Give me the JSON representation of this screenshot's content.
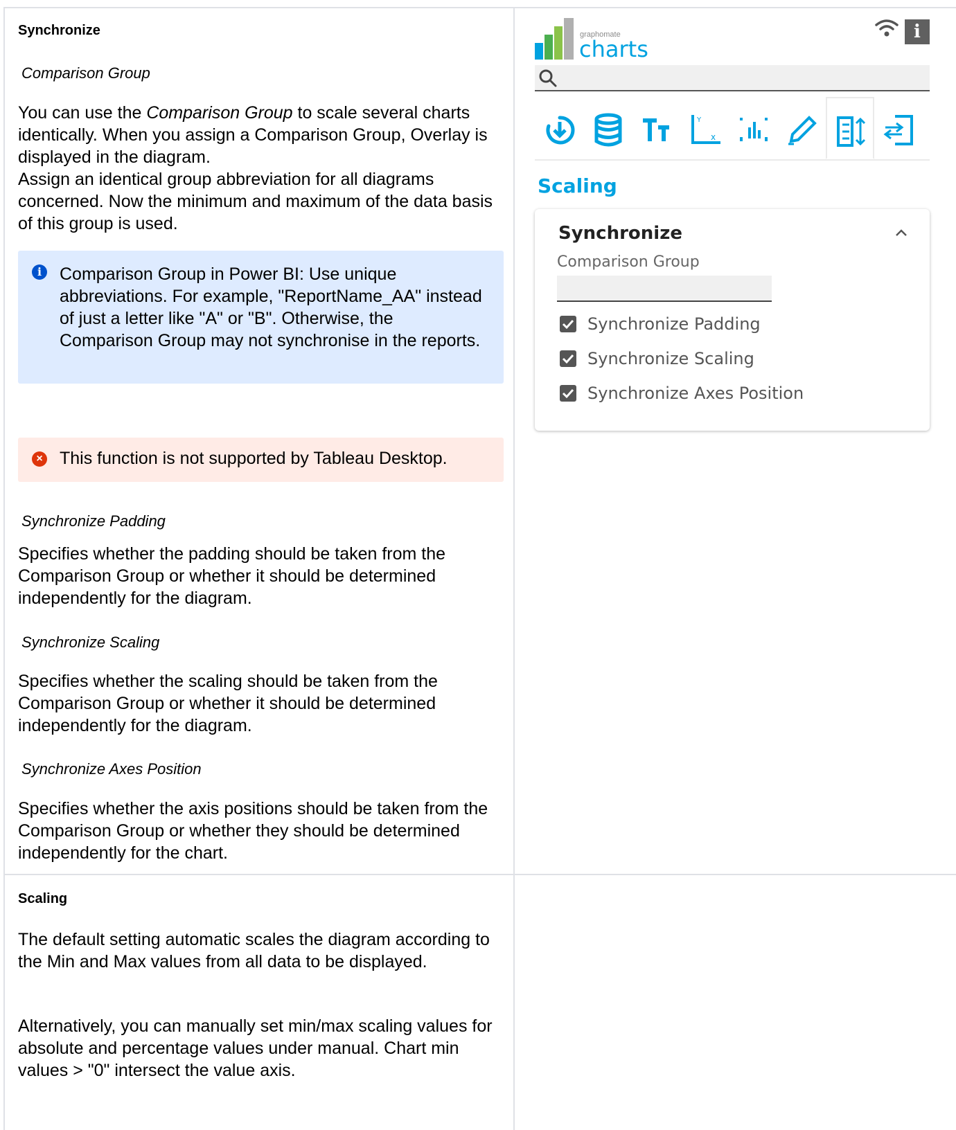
{
  "left_column": {
    "synchronize": {
      "heading": "Synchronize",
      "comparison_group_title": "Comparison Group",
      "comparison_group_text_1": "You can use the ",
      "comparison_group_text_em": "Comparison Group",
      "comparison_group_text_2": " to scale several charts identically. When you assign a Comparison Group, Overlay is displayed in the diagram.",
      "comparison_group_text_3": "Assign an identical group abbreviation for all diagrams concerned. Now the minimum and maximum of the data basis of this group is used.",
      "info_box": "Comparison Group in Power BI: Use unique abbreviations. For example, \"ReportName_AA\" instead of just a letter like \"A\" or \"B\". Otherwise, the Comparison Group may not synchronise in the reports.",
      "error_box": "This function is not supported by Tableau Desktop.",
      "padding_title": "Synchronize Padding",
      "padding_text": "Specifies whether the padding should be taken from the Comparison Group or whether it should be determined independently for the diagram.",
      "scaling_title": "Synchronize Scaling",
      "scaling_text": "Specifies whether the scaling should be taken from the Comparison Group or whether it should be determined independently for the diagram.",
      "axes_title": "Synchronize Axes Position",
      "axes_text": "Specifies whether the axis positions should be taken from the Comparison Group or whether they should be determined independently for the chart."
    },
    "scaling": {
      "heading": "Scaling",
      "text_1": "The default setting automatic scales the diagram according to the Min and Max values from all data to be displayed.",
      "text_2": "Alternatively, you can manually set min/max scaling values for absolute and percentage values under manual. Chart min values > \"0\" intersect the value axis."
    }
  },
  "panel": {
    "logo_small": "graphomate",
    "logo_big": "charts",
    "info_button": "i",
    "section_title": "Scaling",
    "card": {
      "title": "Synchronize",
      "field_label": "Comparison Group",
      "field_value": "",
      "checkboxes": [
        {
          "label": "Synchronize Padding",
          "checked": true
        },
        {
          "label": "Synchronize Scaling",
          "checked": true
        },
        {
          "label": "Synchronize Axes Position",
          "checked": true
        }
      ]
    },
    "icons": [
      "download-icon",
      "database-icon",
      "text-size-icon",
      "axis-icon",
      "bars-icon",
      "pen-icon",
      "scaling-icon",
      "export-icon"
    ],
    "colors": {
      "accent": "#00a2e0",
      "info_bg": "#deebff",
      "error_bg": "#ffebe6"
    }
  }
}
